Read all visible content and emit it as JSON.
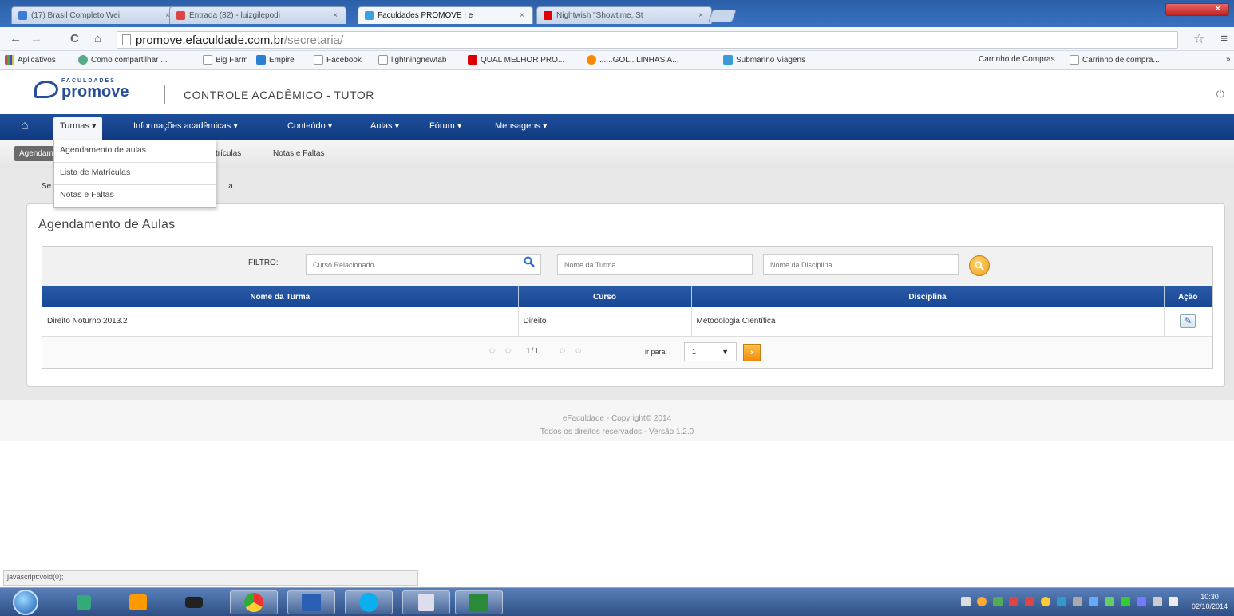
{
  "browser": {
    "tabs": [
      {
        "title": "(17) Brasil Completo Wei",
        "close": "×",
        "color": "#3b7bd6"
      },
      {
        "title": "Entrada (82) - luizgilepodi",
        "close": "×",
        "color": "#d44"
      },
      {
        "title": "Faculdades PROMOVE | e",
        "close": "×",
        "color": "#3aa0e0"
      },
      {
        "title": "Nightwish \"Showtime, St",
        "close": "×",
        "color": "#d00"
      }
    ],
    "window_close": "×",
    "url_host": "promove.efaculdade.com.br",
    "url_path": "/secretaria/",
    "back_icon": "←",
    "forward_icon": "→",
    "reload_icon": "C",
    "home_icon": "⌂",
    "bookmarks": [
      {
        "label": "Aplicativos",
        "icon": "apps-grid"
      },
      {
        "label": "Como compartilhar ...",
        "icon": "people"
      },
      {
        "label": "Big Farm",
        "icon": "page"
      },
      {
        "label": "Empire",
        "icon": "blue-square"
      },
      {
        "label": "Facebook",
        "icon": "page"
      },
      {
        "label": "lightningnewtab",
        "icon": "page"
      },
      {
        "label": "QUAL MELHOR PRO...",
        "icon": "youtube"
      },
      {
        "label": "......GOL...LINHAS A...",
        "icon": "gol"
      },
      {
        "label": "Submarino Viagens",
        "icon": "submarino"
      },
      {
        "label": "Carrinho de Compras",
        "icon": "none"
      },
      {
        "label": "Carrinho de compra...",
        "icon": "page"
      }
    ],
    "bookmark_overflow": "»"
  },
  "app": {
    "logo_small": "FACULDADES",
    "logo_big": "promove",
    "title": "CONTROLE ACADÊMICO - TUTOR",
    "power_icon": "⏻",
    "nav": [
      {
        "label": "Turmas",
        "caret": "▾"
      },
      {
        "label": "Informações acadêmicas",
        "caret": "▾"
      },
      {
        "label": "Conteúdo",
        "caret": "▾"
      },
      {
        "label": "Aulas",
        "caret": "▾"
      },
      {
        "label": "Fórum",
        "caret": "▾"
      },
      {
        "label": "Mensagens",
        "caret": "▾"
      }
    ],
    "home_icon": "⌂",
    "subnav": [
      "Agendamento de aulas",
      "Lista de Matrículas",
      "Notas e Faltas"
    ],
    "subnav_partial": "trículas",
    "dropdown": [
      "Agendamento de aulas",
      "Lista de Matrículas",
      "Notas e Faltas"
    ],
    "breadcrumb_a": "Se",
    "breadcrumb_b": "a"
  },
  "panel": {
    "title": "Agendamento de Aulas",
    "filter_label": "FILTRO:",
    "filter_curso_placeholder": "Curso Relacionado",
    "filter_turma_placeholder": "Nome da Turma",
    "filter_disciplina_placeholder": "Nome da Disciplina",
    "columns": [
      "Nome da Turma",
      "Curso",
      "Disciplina",
      "Ação"
    ],
    "rows": [
      {
        "turma": "Direito Noturno 2013.2",
        "curso": "Direito",
        "disciplina": "Metodologia Científica"
      }
    ],
    "pager_text": "1/1",
    "ir_para": "ir para:",
    "page_select": "1",
    "select_caret": "▼"
  },
  "footer": {
    "line1": "eFaculdade - Copyright© 2014",
    "line2": "Todos os direitos reservados - Versão 1.2.0"
  },
  "status_text": "javascript:void(0);",
  "taskbar": {
    "clock_time": "10:30",
    "clock_date": "02/10/2014"
  }
}
